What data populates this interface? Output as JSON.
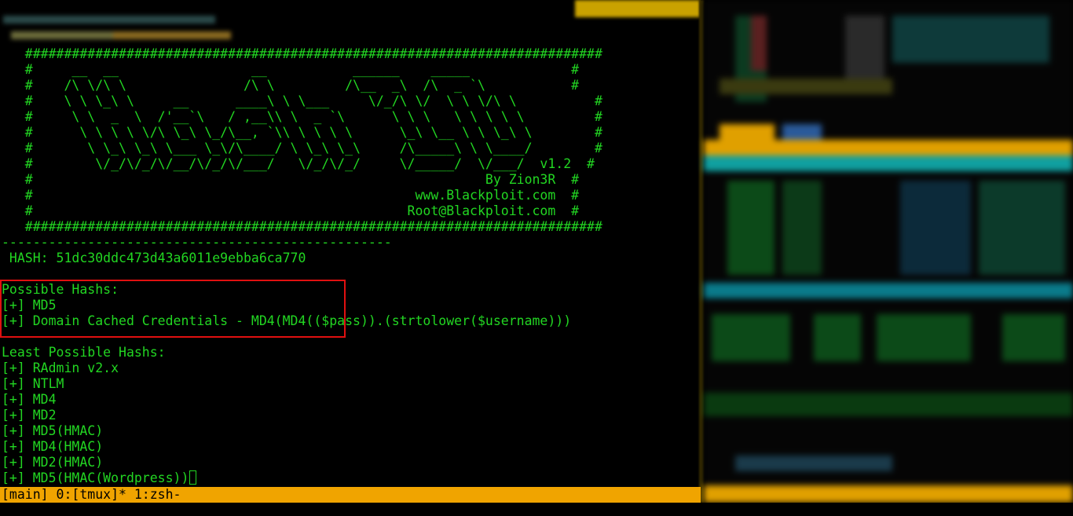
{
  "terminal": {
    "banner": [
      "   ##########################################################################",
      "   #     __  __                 __           ______    _____             #",
      "   #    /\\ \\/\\ \\               /\\ \\         /\\__  _\\  /\\  _ `\\           #",
      "   #    \\ \\ \\_\\ \\     __      ____\\ \\ \\___     \\/_/\\ \\/  \\ \\ \\/\\ \\          #",
      "   #     \\ \\  _  \\  /'__`\\   / ,__\\\\ \\  _ `\\      \\ \\ \\   \\ \\ \\ \\ \\         #",
      "   #      \\ \\ \\ \\ \\/\\ \\_\\ \\_/\\__, `\\\\ \\ \\ \\ \\      \\_\\ \\__ \\ \\ \\_\\ \\        #",
      "   #       \\ \\_\\ \\_\\ \\___ \\_\\/\\____/ \\ \\_\\ \\_\\     /\\_____\\ \\ \\____/        #",
      "   #        \\/_/\\/_/\\/__/\\/_/\\/___/   \\/_/\\/_/     \\/_____/  \\/___/  v1.2  #",
      "   #                                                          By Zion3R  #",
      "   #                                                 www.Blackploit.com  #",
      "   #                                                Root@Blackploit.com  #",
      "   ##########################################################################"
    ],
    "separator": "--------------------------------------------------",
    "hash_line": " HASH: 51dc30ddc473d43a6011e9ebba6ca770",
    "possible_header": "Possible Hashs:",
    "possible": [
      "[+] MD5",
      "[+] Domain Cached Credentials - MD4(MD4(($pass)).(strtolower($username)))"
    ],
    "least_header": "Least Possible Hashs:",
    "least": [
      "[+] RAdmin v2.x",
      "[+] NTLM",
      "[+] MD4",
      "[+] MD2",
      "[+] MD5(HMAC)",
      "[+] MD4(HMAC)",
      "[+] MD2(HMAC)",
      "[+] MD5(HMAC(Wordpress))"
    ]
  },
  "statusbar": {
    "text": "[main] 0:[tmux]* 1:zsh-"
  },
  "colors": {
    "terminal_fg": "#22d622",
    "status_bg": "#f0a400",
    "highlight_border": "#e01010"
  }
}
